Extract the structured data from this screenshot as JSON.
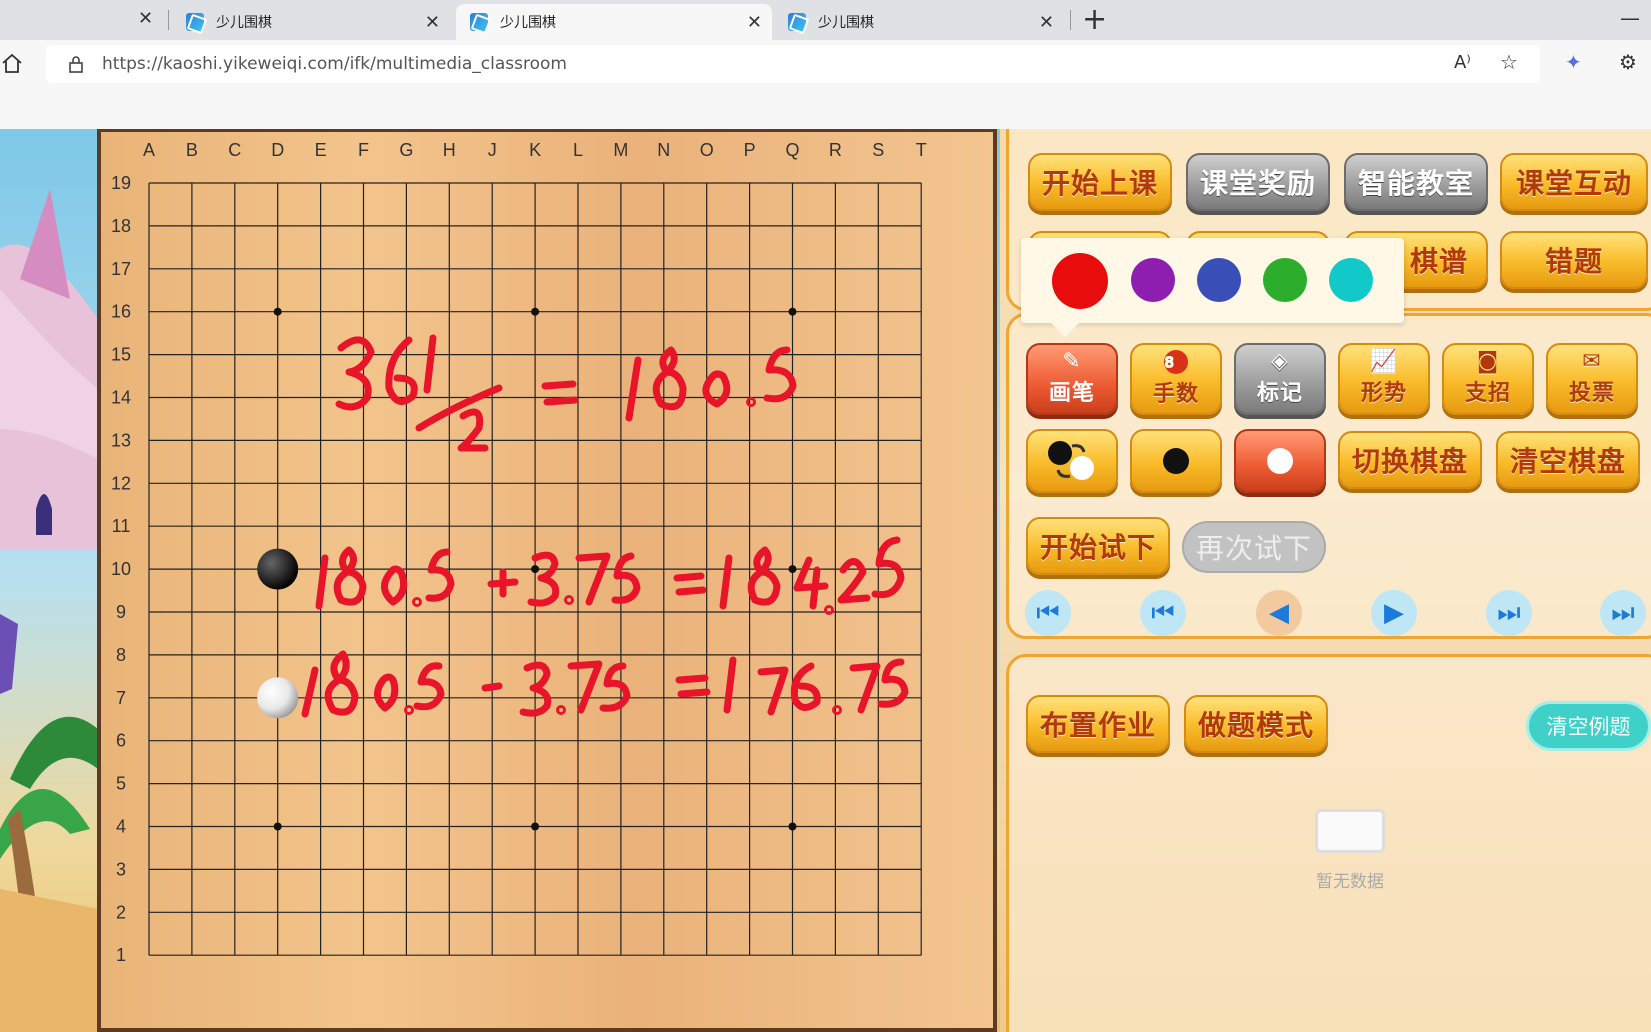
{
  "browser": {
    "tabs": [
      {
        "title": "少儿围棋",
        "active": false
      },
      {
        "title": "少儿围棋",
        "active": true
      },
      {
        "title": "少儿围棋",
        "active": false
      }
    ],
    "new_tab": "+",
    "close": "✕",
    "minimize": "—",
    "url": "https://kaoshi.yikeweiqi.com/ifk/multimedia_classroom",
    "icons": [
      "home-icon",
      "lock-icon",
      "read-aloud-icon",
      "favorite-icon",
      "extension-icon",
      "settings-icon"
    ]
  },
  "board": {
    "size": 19,
    "col_labels": [
      "A",
      "B",
      "C",
      "D",
      "E",
      "F",
      "G",
      "H",
      "J",
      "K",
      "L",
      "M",
      "N",
      "O",
      "P",
      "Q",
      "R",
      "S",
      "T"
    ],
    "row_labels": [
      "19",
      "18",
      "17",
      "16",
      "15",
      "14",
      "13",
      "12",
      "11",
      "10",
      "9",
      "8",
      "7",
      "6",
      "5",
      "4",
      "3",
      "2",
      "1"
    ],
    "stones": [
      {
        "color": "black",
        "point": "D10"
      },
      {
        "color": "white",
        "point": "D7"
      }
    ],
    "hoshi": [
      "D16",
      "K16",
      "Q16",
      "D10",
      "K10",
      "Q10",
      "D4",
      "K4",
      "Q4"
    ],
    "annotations": {
      "line1": "361/2 = 180.5",
      "line2": "180.5 + 3.75 = 184.25",
      "line3": "180.5 - 3.75 = 176.75",
      "ink_color": "#e8142a"
    }
  },
  "panel": {
    "top_buttons": [
      "开始上课",
      "课堂奖励",
      "智能教室",
      "课堂互动"
    ],
    "second_row": [
      "棋谱",
      "错题"
    ],
    "color_picker": [
      "#e80c0c",
      "#8e1eb0",
      "#3a4eb8",
      "#2cae2c",
      "#12c9c9"
    ],
    "tools": [
      "画笔",
      "手数",
      "标记",
      "形势",
      "支招",
      "投票"
    ],
    "tool_icons": [
      "pen-icon",
      "move-number-icon",
      "mark-icon",
      "situation-icon",
      "hint-icon",
      "vote-icon"
    ],
    "move_number_badge": "8",
    "stone_buttons": [
      "swap-stones",
      "black-stone",
      "white-stone"
    ],
    "board_buttons": [
      "切换棋盘",
      "清空棋盘"
    ],
    "try_buttons": [
      "开始试下",
      "再次试下"
    ],
    "nav_buttons": [
      "first",
      "prev10",
      "prev",
      "next",
      "next10",
      "last"
    ],
    "homework_buttons": [
      "布置作业",
      "做题模式"
    ],
    "clear_examples": "清空例题",
    "empty_text": "暂无数据"
  }
}
